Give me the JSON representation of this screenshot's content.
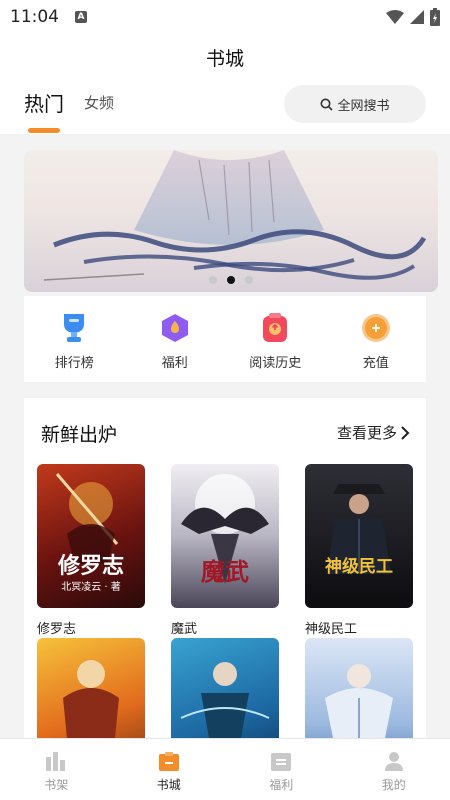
{
  "status": {
    "time": "11:04",
    "notification_glyph": "A"
  },
  "header": {
    "title": "书城",
    "tabs": [
      {
        "label": "热门",
        "active": true
      },
      {
        "label": "女频",
        "active": false
      }
    ],
    "search_label": "全网搜书"
  },
  "banner": {
    "dots": 3,
    "active_dot": 1
  },
  "quick_actions": [
    {
      "label": "排行榜",
      "icon": "trophy-icon",
      "color": "#3b8df0"
    },
    {
      "label": "福利",
      "icon": "gift-hexagon-icon",
      "color": "#8f5cf2"
    },
    {
      "label": "阅读历史",
      "icon": "history-icon",
      "color": "#f24a5c"
    },
    {
      "label": "充值",
      "icon": "coin-icon",
      "color": "#f5a037"
    }
  ],
  "fresh": {
    "title": "新鲜出炉",
    "see_more": "查看更多",
    "books": [
      {
        "name": "修罗志",
        "cover_title": "修罗志",
        "cover_sub": "北冥凌云 · 著",
        "cover_colors": [
          "#6b1310",
          "#c23a1c",
          "#2a0a0a"
        ]
      },
      {
        "name": "魔武",
        "cover_title": "魔武",
        "cover_sub": "",
        "cover_colors": [
          "#f0eef2",
          "#b9b6c4",
          "#4a4658"
        ]
      },
      {
        "name": "神级民工",
        "cover_title": "神级民工",
        "cover_sub": "",
        "cover_colors": [
          "#0d0d10",
          "#2e2e36",
          "#121216"
        ]
      }
    ],
    "books_row2": [
      {
        "name": "",
        "cover_title": "",
        "cover_colors": [
          "#f6c23a",
          "#e26b1d",
          "#6b2b10"
        ]
      },
      {
        "name": "",
        "cover_title": "",
        "cover_colors": [
          "#1d6aa5",
          "#39a3d1",
          "#0c3155"
        ]
      },
      {
        "name": "",
        "cover_title": "",
        "cover_colors": [
          "#dbe6f5",
          "#9bb9df",
          "#4b6fa4"
        ]
      }
    ]
  },
  "bottom_nav": [
    {
      "label": "书架",
      "icon": "bookshelf-icon",
      "active": false
    },
    {
      "label": "书城",
      "icon": "bookstore-icon",
      "active": true
    },
    {
      "label": "福利",
      "icon": "welfare-icon",
      "active": false
    },
    {
      "label": "我的",
      "icon": "profile-icon",
      "active": false
    }
  ],
  "colors": {
    "accent": "#f28d2a",
    "active_nav": "#f28d2a",
    "inactive_nav": "#c8c8c8"
  }
}
